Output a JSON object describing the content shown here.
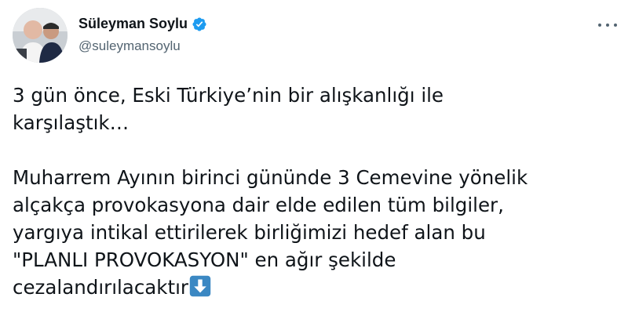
{
  "author": {
    "display_name": "Süleyman Soylu",
    "handle": "@suleymansoylu",
    "verified_color": "#1d9bf0"
  },
  "menu": {
    "icon": "more-horizontal-icon"
  },
  "tweet": {
    "paragraph1": [
      "3 gün önce, Eski Türkiye’nin bir alışkanlığı ile",
      "karşılaştık…"
    ],
    "paragraph2": [
      "Muharrem Ayının birinci gününde 3 Cemevine yönelik",
      "alçakça provokasyona dair elde edilen tüm bilgiler,",
      "yargıya intikal ettirilerek birliğimizi hedef alan bu",
      "\"PLANLI PROVOKASYON\" en ağır şekilde",
      "cezalandırılacaktır"
    ],
    "trailing_emoji": "down-arrow-emoji"
  }
}
